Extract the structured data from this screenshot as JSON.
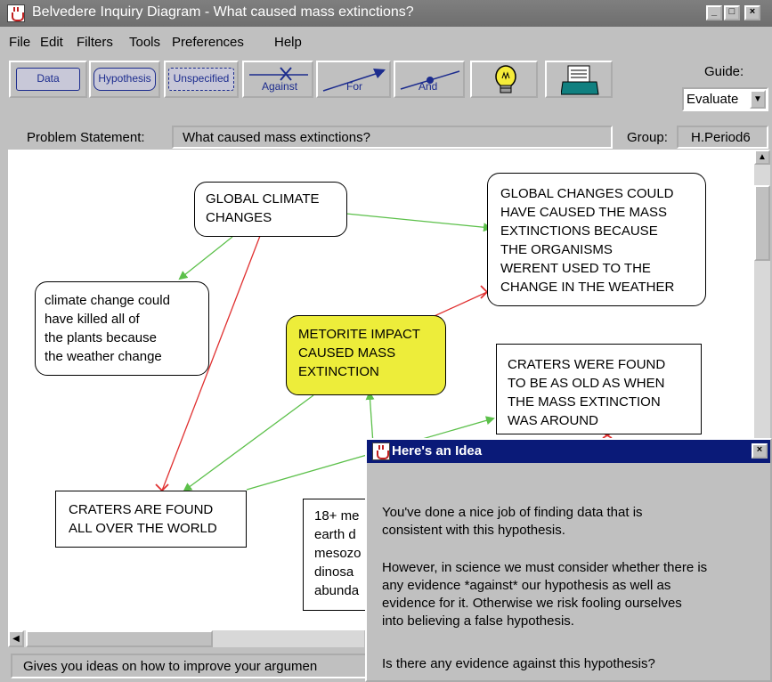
{
  "window": {
    "title": "Belvedere Inquiry Diagram - What caused mass extinctions?",
    "min_glyph": "_",
    "max_glyph": "□",
    "close_glyph": "×"
  },
  "menu": [
    "File",
    "Edit",
    "Filters",
    "Tools",
    "Preferences",
    "Help"
  ],
  "toolbar": {
    "data_label": "Data",
    "hypothesis_label": "Hypothesis",
    "unspecified_label": "Unspecified",
    "against_label": "Against",
    "for_label": "For",
    "and_label": "And",
    "guide_label": "Guide:",
    "guide_value": "Evaluate"
  },
  "problem": {
    "label": "Problem Statement:",
    "value": "What caused mass extinctions?",
    "group_label": "Group:",
    "group_value": "H.Period6"
  },
  "nodes": {
    "global_climate": "GLOBAL CLIMATE\nCHANGES",
    "global_changes": "GLOBAL CHANGES COULD\nHAVE CAUSED THE MASS\nEXTINCTIONS BECAUSE\nTHE ORGANISMS\nWERENT USED TO THE\nCHANGE IN THE WEATHER",
    "climate_plants": "climate change could\nhave killed all of\nthe plants because\nthe weather change",
    "meteorite": "METORITE IMPACT\nCAUSED MASS\nEXTINCTION",
    "craters_old": "CRATERS WERE FOUND\nTO BE AS OLD AS WHEN\nTHE MASS EXTINCTION\nWAS AROUND",
    "craters_world": "CRATERS ARE FOUND\nALL OVER THE WORLD",
    "partial_node": "18+ me\nearth d\nmesozo\ndinosa\nabunda"
  },
  "status_bar": "Gives you ideas on how to improve your argumen",
  "dialog": {
    "title": "Here's an Idea",
    "close_glyph": "×",
    "p1": "You've done a nice job of finding data that is\nconsistent with this hypothesis.",
    "p2": "However, in science we must consider whether there is\nany evidence *against* our hypothesis as well as\nevidence for it. Otherwise we risk fooling ourselves\ninto believing a false hypothesis.",
    "p3": "Is there any evidence against this hypothesis?"
  },
  "colors": {
    "for_link": "#5cc04a",
    "against_link": "#e03030",
    "hypothesis_highlight": "#eded3a",
    "dialog_title": "#0a1a78"
  }
}
